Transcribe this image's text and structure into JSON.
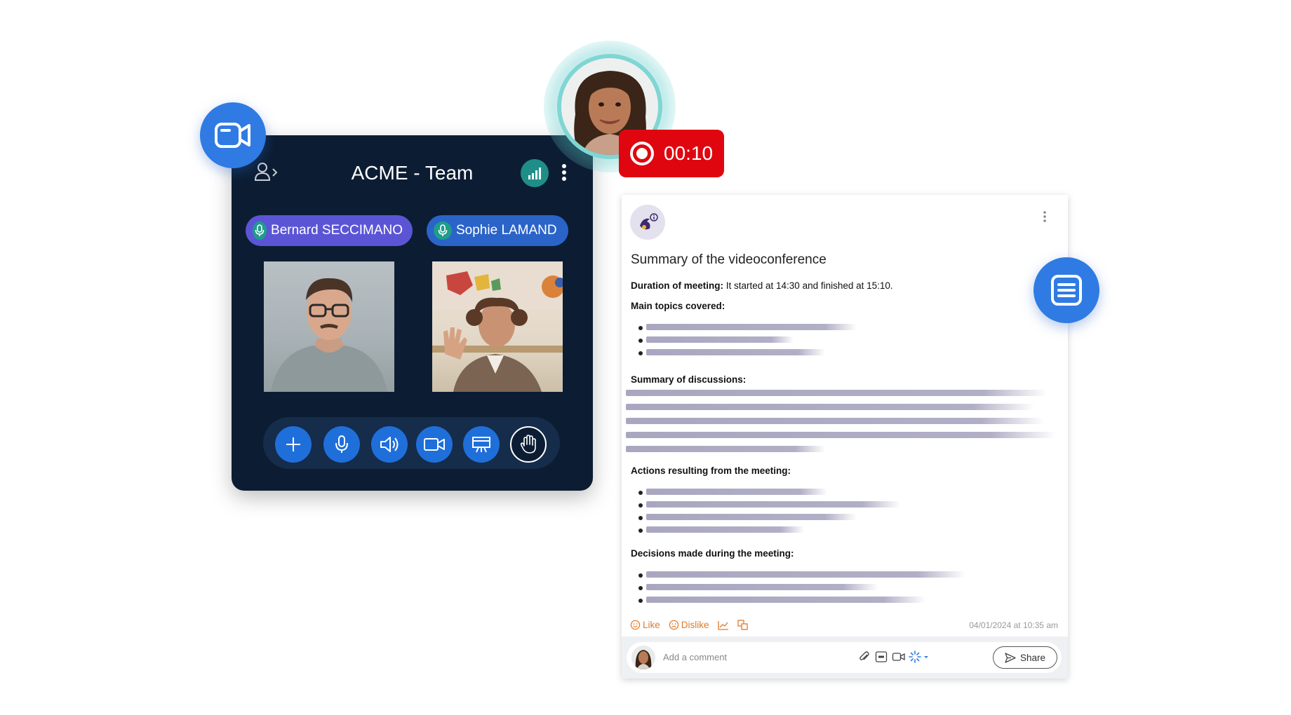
{
  "conference": {
    "title": "ACME  - Team",
    "participants": [
      {
        "name": "Bernard SECCIMANO"
      },
      {
        "name": "Sophie LAMAND"
      }
    ],
    "controls": [
      "add-icon",
      "microphone-icon",
      "speaker-icon",
      "camera-icon",
      "presentation-icon",
      "raise-hand-icon"
    ]
  },
  "recording": {
    "timer": "00:10",
    "color": "#e0060f"
  },
  "summary": {
    "title": "Summary of the videoconference",
    "duration_label": "Duration of meeting:",
    "duration_text": " It started at 14:30 and finished at 15:10.",
    "main_topics_label": "Main topics covered:",
    "discussions_label": "Summary of discussions:",
    "actions_label": "Actions resulting from the meeting:",
    "decisions_label": "Decisions made during the meeting:",
    "like_label": "Like",
    "dislike_label": "Dislike",
    "timestamp": "04/01/2024 at 10:35 am"
  },
  "comment": {
    "placeholder": "Add a comment",
    "share_label": "Share"
  },
  "colors": {
    "panel_bg": "#0c1d33",
    "accent_blue": "#2f7be3",
    "reaction_orange": "#e07a2a"
  }
}
